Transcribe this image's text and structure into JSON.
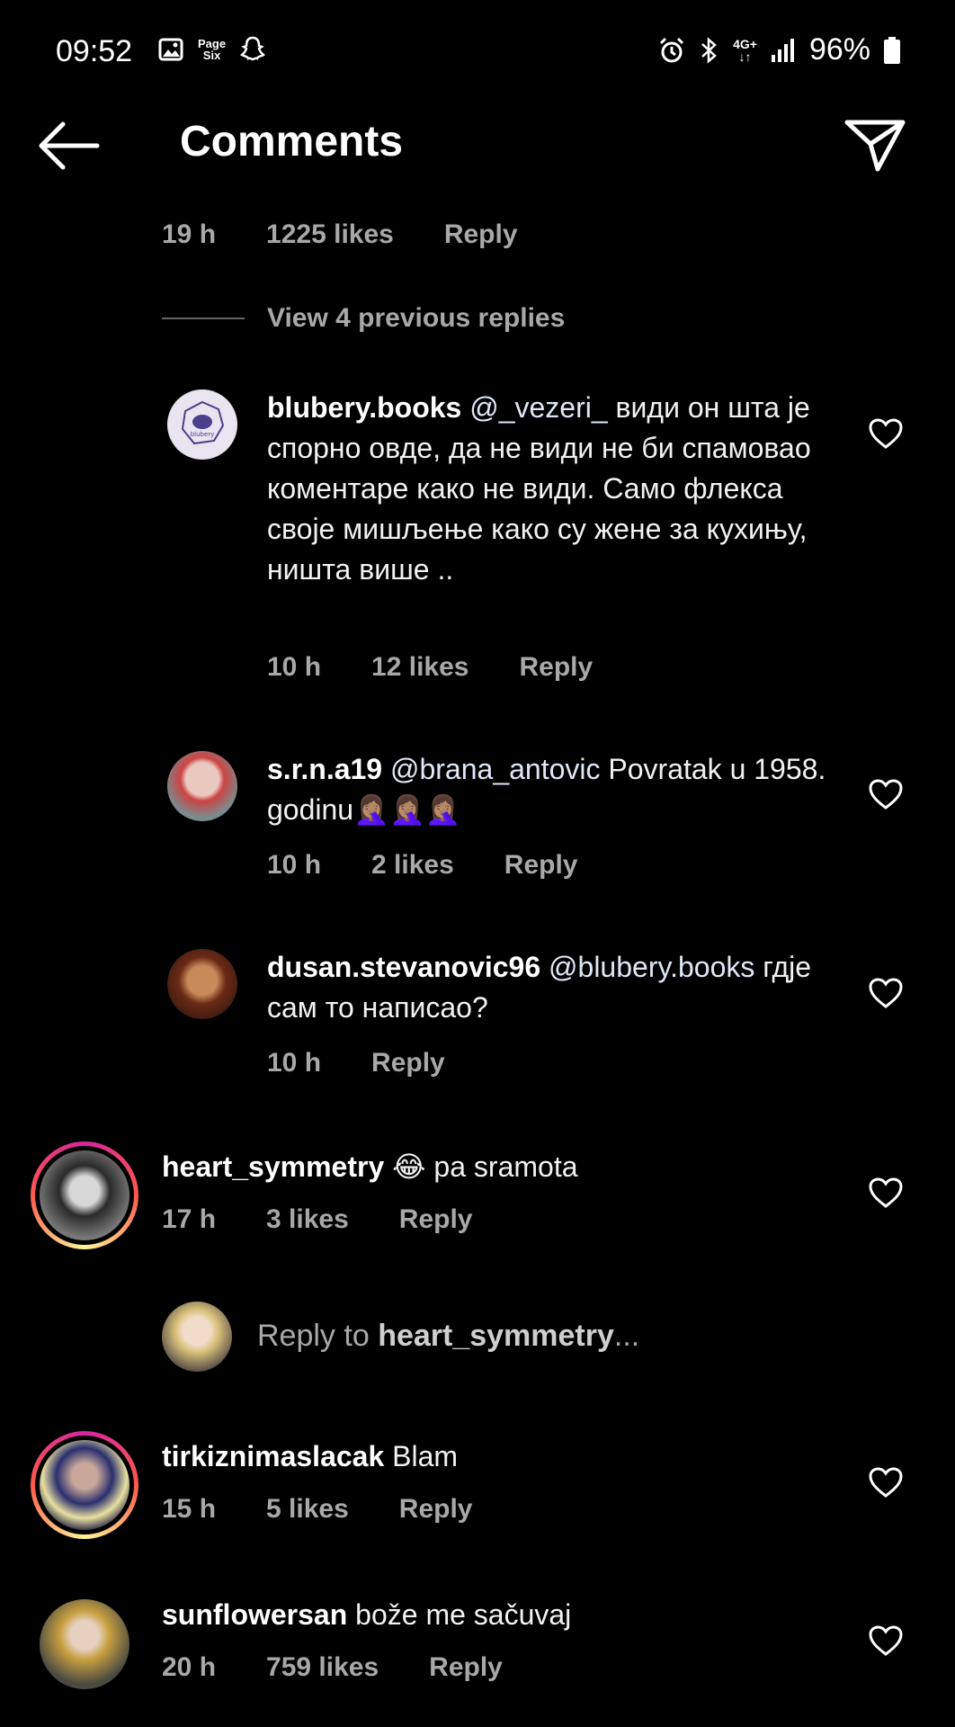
{
  "status": {
    "time": "09:52",
    "page_six_top": "Page",
    "page_six_bottom": "Six",
    "network_top": "4G+",
    "network_bottom": "↓↑",
    "battery": "96%"
  },
  "header": {
    "title": "Comments"
  },
  "top_meta": {
    "time": "19 h",
    "likes": "1225 likes",
    "reply": "Reply"
  },
  "view_previous": "View 4 previous replies",
  "replies": [
    {
      "username": "blubery.books",
      "mention": "@_vezeri_",
      "text": " види он шта је спорно овде, да не види не би спамовао коментаре како не види. Само флекса своје мишљење како су жене за кухињу, ништа више ..",
      "time": "10 h",
      "likes": "12 likes",
      "reply": "Reply"
    },
    {
      "username": "s.r.n.a19",
      "mention": "@brana_antovic",
      "text": " Povratak u 1958. godinu🤦🏽‍♀️🤦🏽‍♀️🤦🏽‍♀️",
      "time": "10 h",
      "likes": "2 likes",
      "reply": "Reply"
    },
    {
      "username": "dusan.stevanovic96",
      "mention": "@blubery.books",
      "text": " гдје сам то написао?",
      "time": "10 h",
      "reply": "Reply"
    }
  ],
  "comments": [
    {
      "username": "heart_symmetry",
      "text": " 😂 pa sramota",
      "time": "17 h",
      "likes": "3 likes",
      "reply": "Reply"
    },
    {
      "username": "tirkiznimaslacak",
      "text": " Blam",
      "time": "15 h",
      "likes": "5 likes",
      "reply": "Reply"
    },
    {
      "username": "sunflowersan",
      "text": " bože me sačuvaj",
      "time": "20 h",
      "likes": "759 likes",
      "reply": "Reply"
    }
  ],
  "reply_box": {
    "prefix": "Reply to ",
    "target": "heart_symmetry",
    "suffix": "..."
  },
  "colors": {
    "background": "#000000",
    "meta_text": "#a8a8a8",
    "story_ring": "#d6249f"
  }
}
